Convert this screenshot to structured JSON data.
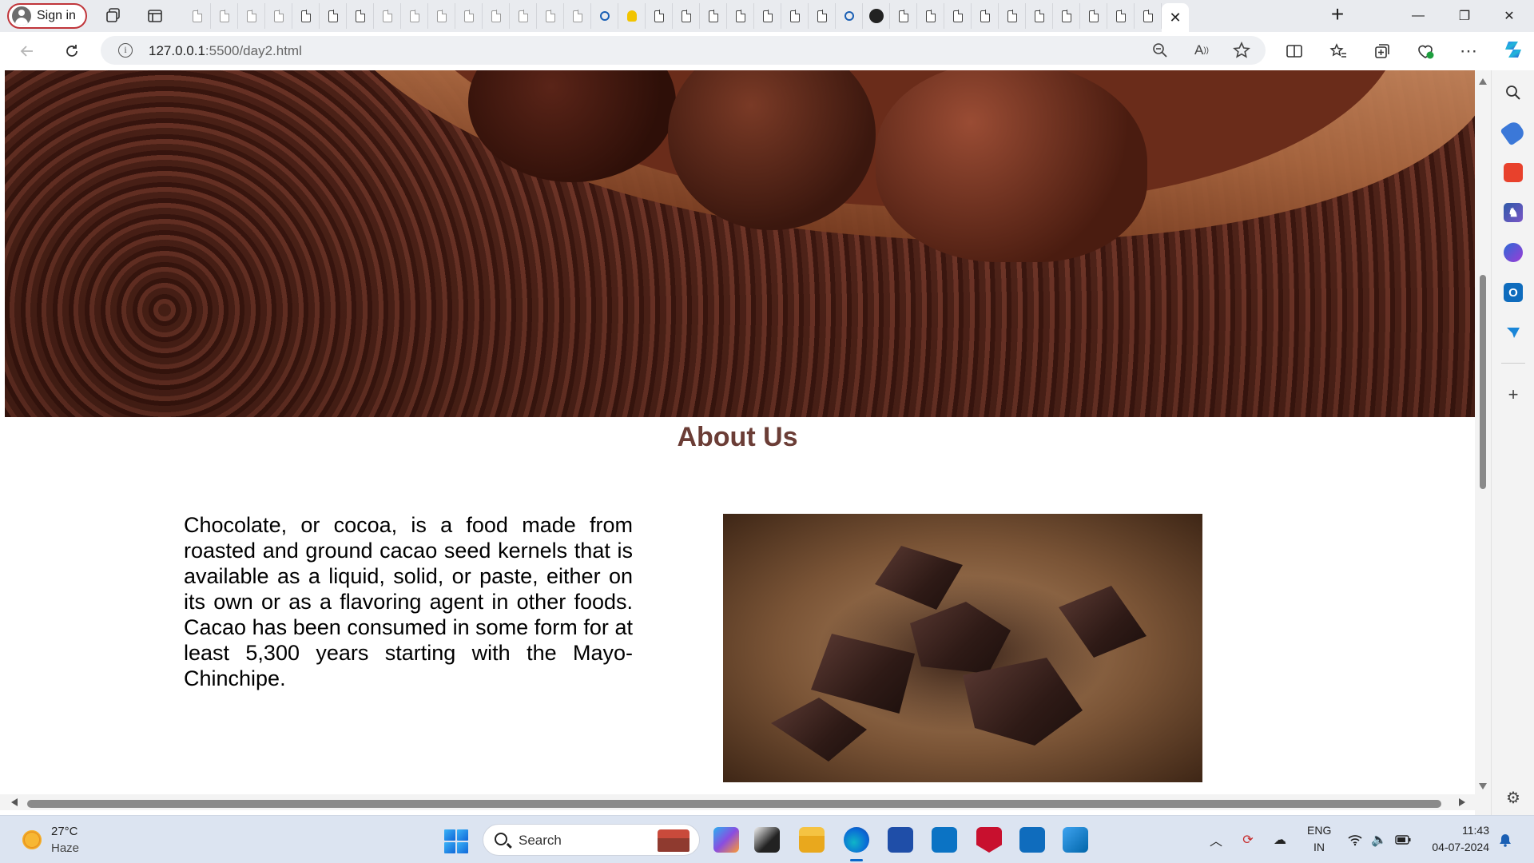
{
  "browser": {
    "signin_label": "Sign in",
    "address": {
      "host": "127.0.0.1",
      "path": ":5500/day2.html"
    },
    "window_controls": {
      "minimize": "—",
      "restore": "❐",
      "close": "✕"
    },
    "new_tab": "+",
    "active_tab_close": "✕"
  },
  "page": {
    "about_title": "About Us",
    "about_text": "Chocolate, or cocoa, is a food made from roasted and ground cacao seed kernels that is available as a liquid, solid, or paste, either on its own or as a flavoring agent in other foods. Cacao has been consumed in some form for at least 5,300 years starting with the Mayo-Chinchipe.",
    "title_color": "#6b3d36"
  },
  "taskbar": {
    "weather_temp": "27°C",
    "weather_desc": "Haze",
    "search_label": "Search",
    "lang_line1": "ENG",
    "lang_line2": "IN",
    "time": "11:43",
    "date": "04-07-2024"
  },
  "icons": {
    "toolbar": [
      "back-icon",
      "refresh-icon",
      "info-icon",
      "zoom-out-icon",
      "read-aloud-icon",
      "favorite-star-icon",
      "split-screen-icon",
      "favorites-icon",
      "collections-icon",
      "browser-essentials-icon",
      "more-icon",
      "copilot-icon"
    ],
    "sidebar": [
      "search-icon",
      "tag-icon",
      "toolbox-icon",
      "chess-icon",
      "office-icon",
      "outlook-icon",
      "send-icon",
      "add-icon",
      "settings-icon"
    ]
  }
}
